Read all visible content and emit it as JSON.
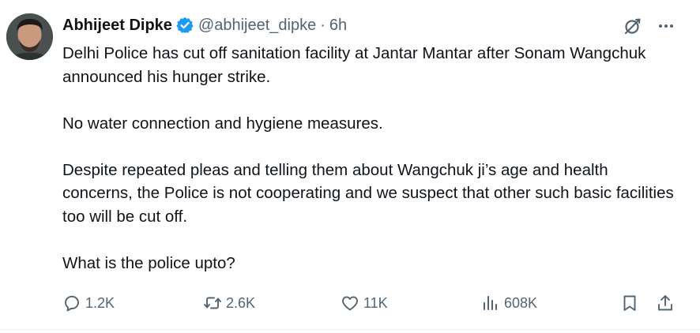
{
  "author": {
    "name": "Abhijeet Dipke",
    "handle": "@abhijeet_dipke",
    "separator": "·",
    "time": "6h",
    "verified_color": "#1d9bf0"
  },
  "icons": {
    "avatar": "profile-photo",
    "verified": "verified-badge-icon",
    "grok": "grok-icon",
    "more": "more-icon"
  },
  "body": {
    "paragraphs": [
      "Delhi Police has cut off sanitation facility at Jantar Mantar after Sonam Wangchuk announced his hunger strike.",
      "No water connection and hygiene measures.",
      "Despite repeated pleas and telling them about Wangchuk ji’s age and health concerns, the Police is not cooperating and we suspect that other such basic facilities too will be cut off.",
      "What is the police upto?"
    ]
  },
  "actions": {
    "replies": "1.2K",
    "reposts": "2.6K",
    "likes": "11K",
    "views": "608K"
  },
  "colors": {
    "text": "#0f1419",
    "secondary": "#536471",
    "divider": "#eff3f4"
  }
}
